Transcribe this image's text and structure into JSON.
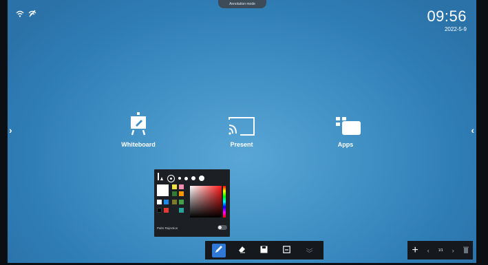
{
  "top_tab": {
    "label": "Annotation mode"
  },
  "status_icons": [
    "wifi-icon",
    "wifi-off-icon"
  ],
  "clock": {
    "time": "09:56",
    "date": "2022-5-9"
  },
  "nav": {
    "left_arrow": "›",
    "right_arrow": "‹"
  },
  "tiles": [
    {
      "label": "Whiteboard",
      "icon": "whiteboard-icon"
    },
    {
      "label": "Present",
      "icon": "cast-icon"
    },
    {
      "label": "Apps",
      "icon": "apps-icon"
    }
  ],
  "pen_panel": {
    "palm_rejection_label": "Palm Rejection",
    "palm_rejection_on": false,
    "colors": [
      "#ffffff",
      "#f5e142",
      "#f48fb1",
      "#2e7d32",
      "#e57373",
      "#ff9800",
      "#1e88e5",
      "#43a047",
      "#7cb342",
      "#000000",
      "#e53935",
      "#26a69a"
    ]
  },
  "toolbar": {
    "tools": [
      "pen-icon",
      "eraser-icon",
      "save-icon",
      "window-icon",
      "layers-icon"
    ],
    "active_tool": "pen-icon"
  },
  "pager": {
    "page": "1/1"
  }
}
